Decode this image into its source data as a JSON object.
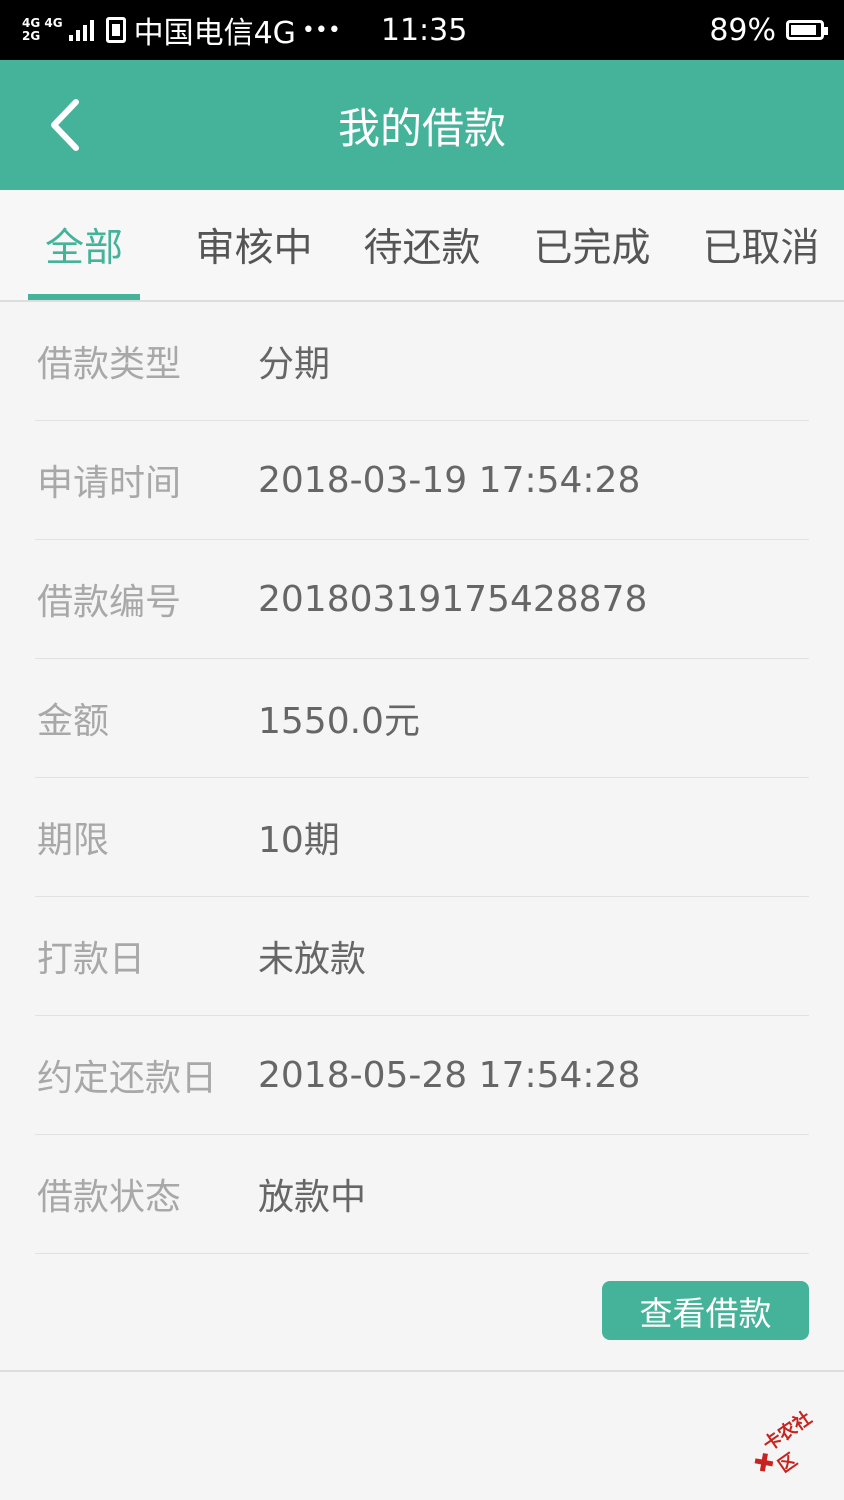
{
  "status_bar": {
    "network_top": "4G 4G",
    "network_bottom": "2G",
    "carrier": "中国电信4G",
    "more": "•••",
    "time": "11:35",
    "battery": "89%",
    "battery_level": 0.89
  },
  "header": {
    "title": "我的借款",
    "back_icon": "chevron-left-icon"
  },
  "tabs": [
    {
      "label": "全部",
      "active": true
    },
    {
      "label": "审核中",
      "active": false
    },
    {
      "label": "待还款",
      "active": false
    },
    {
      "label": "已完成",
      "active": false
    },
    {
      "label": "已取消",
      "active": false
    }
  ],
  "loan": {
    "rows": [
      {
        "label": "借款类型",
        "value": "分期"
      },
      {
        "label": "申请时间",
        "value": "2018-03-19 17:54:28"
      },
      {
        "label": "借款编号",
        "value": "20180319175428878"
      },
      {
        "label": "金额",
        "value": "1550.0元"
      },
      {
        "label": "期限",
        "value": "10期"
      },
      {
        "label": "打款日",
        "value": "未放款"
      },
      {
        "label": "约定还款日",
        "value": "2018-05-28 17:54:28"
      },
      {
        "label": "借款状态",
        "value": "放款中"
      }
    ],
    "view_button": "查看借款"
  },
  "watermark": {
    "text": "卡农社区"
  },
  "colors": {
    "accent": "#45b39a",
    "label": "#a8a8a8",
    "value": "#666666",
    "background": "#f5f5f5"
  }
}
